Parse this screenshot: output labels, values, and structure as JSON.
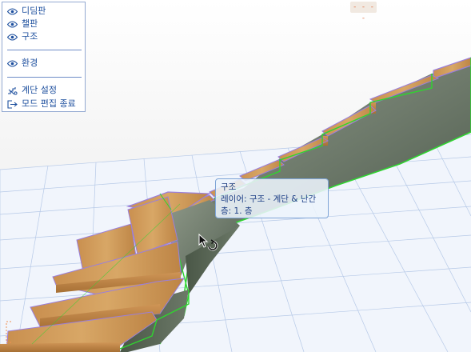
{
  "menu": {
    "items": [
      {
        "label": "디딤판",
        "icon": "eye-icon"
      },
      {
        "label": "챌판",
        "icon": "eye-icon"
      },
      {
        "label": "구조",
        "icon": "eye-icon"
      },
      {
        "label": "환경",
        "icon": "eye-icon"
      },
      {
        "label": "계단 설정",
        "icon": "stair-settings-icon"
      },
      {
        "label": "모드 편집 종료",
        "icon": "exit-icon"
      }
    ]
  },
  "tooltip": {
    "title": "구조",
    "layer": "레이어: 구조 - 계단 & 난간",
    "story": "층: 1. 층"
  },
  "top_marker": "- - - -",
  "colors": {
    "accent": "#1d4f9e",
    "outline": "#2fd52f",
    "tread_edge": "#9a7fdc",
    "wood": "#c58f4e",
    "concrete": "#6f7b6d",
    "grid": "#aec4e6"
  }
}
